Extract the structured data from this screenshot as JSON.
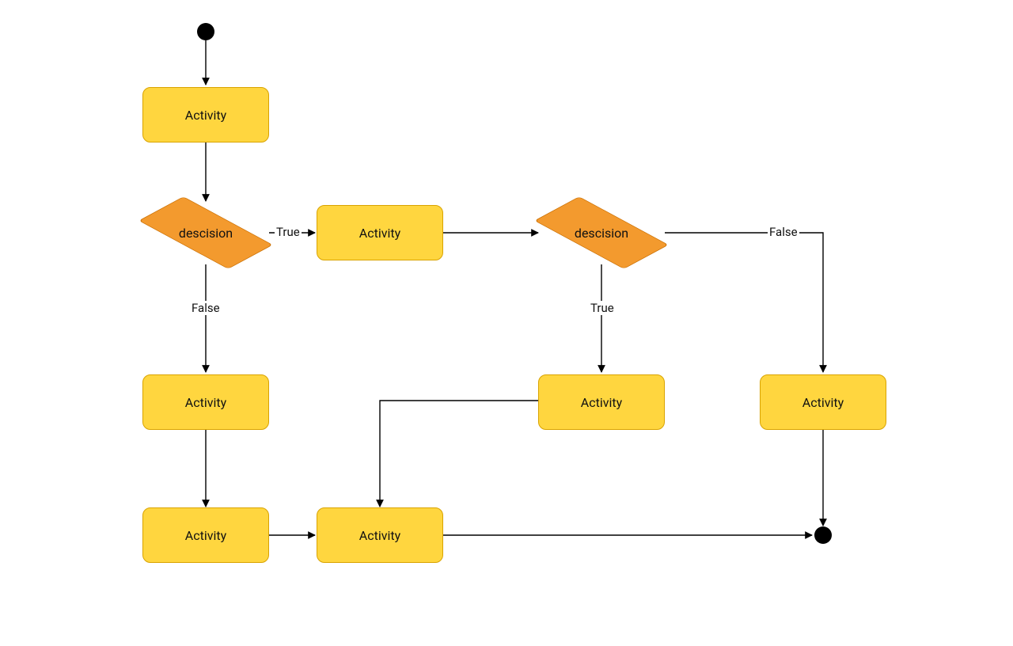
{
  "nodes": {
    "a1": "Activity",
    "d1": "descision",
    "a2": "Activity",
    "d2": "descision",
    "a3": "Activity",
    "a4": "Activity",
    "a5": "Activity",
    "a6": "Activity",
    "a7": "Activity"
  },
  "edgeLabels": {
    "d1_true": "True",
    "d1_false": "False",
    "d2_true": "True",
    "d2_false": "False"
  },
  "diagram": {
    "type": "uml-activity",
    "start": "start",
    "end": "end",
    "flow": [
      [
        "start",
        "a1"
      ],
      [
        "a1",
        "d1"
      ],
      [
        "d1",
        "a2",
        "True"
      ],
      [
        "d1",
        "a3",
        "False"
      ],
      [
        "a2",
        "d2"
      ],
      [
        "d2",
        "a4",
        "True"
      ],
      [
        "d2",
        "a5",
        "False"
      ],
      [
        "a3",
        "a6"
      ],
      [
        "a4",
        "a7"
      ],
      [
        "a6",
        "a7"
      ],
      [
        "a5",
        "end"
      ],
      [
        "a7",
        "end"
      ]
    ]
  }
}
